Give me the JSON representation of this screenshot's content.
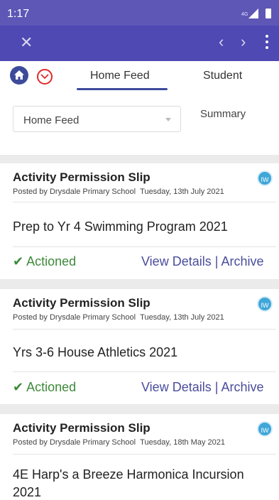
{
  "status_bar": {
    "time": "1:17",
    "network": "4G"
  },
  "app_bar": {
    "close_icon": "close-icon",
    "prev_icon": "chevron-left-icon",
    "next_icon": "chevron-right-icon",
    "more_icon": "more-vert-icon"
  },
  "tabs": {
    "home_icon": "home-icon",
    "dropdown_icon": "chevron-down-icon",
    "items": [
      {
        "label": "Home Feed",
        "active": true
      },
      {
        "label": "Student",
        "active": false
      }
    ]
  },
  "filter": {
    "selected": "Home Feed",
    "summary_label": "Summary"
  },
  "feed": [
    {
      "title": "Activity Permission Slip",
      "posted_by": "Posted by Drysdale Primary School",
      "date": "Tuesday, 13th July 2021",
      "avatar": "IW",
      "description": "Prep to Yr 4 Swimming Program 2021",
      "status": "Actioned",
      "view_label": "View Details",
      "separator": "|",
      "archive_label": "Archive"
    },
    {
      "title": "Activity Permission Slip",
      "posted_by": "Posted by Drysdale Primary School",
      "date": "Tuesday, 13th July 2021",
      "avatar": "IW",
      "description": "Yrs 3-6 House Athletics 2021",
      "status": "Actioned",
      "view_label": "View Details",
      "separator": "|",
      "archive_label": "Archive"
    },
    {
      "title": "Activity Permission Slip",
      "posted_by": "Posted by Drysdale Primary School",
      "date": "Tuesday, 18th May 2021",
      "avatar": "IW",
      "description": "4E Harp's a Breeze Harmonica Incursion 2021"
    }
  ],
  "colors": {
    "status_bar": "#5e57b6",
    "app_bar": "#4e49b3",
    "accent": "#3d4b9b",
    "actioned": "#3e8a3a",
    "link": "#4a4d9c",
    "avatar": "#3fa6d8"
  }
}
